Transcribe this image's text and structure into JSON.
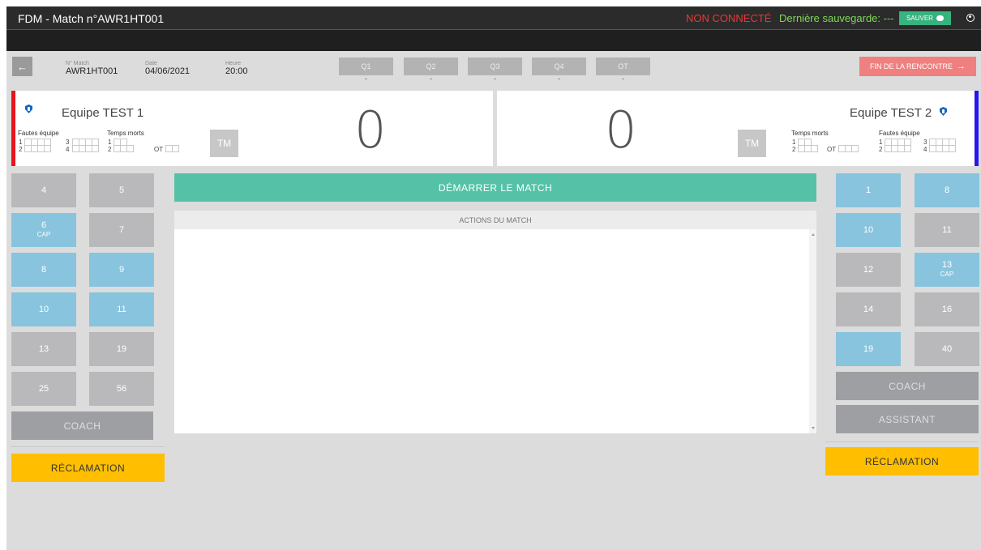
{
  "app": {
    "title": "FDM - Match n°AWR1HT001",
    "connection_status": "NON CONNECTÉ",
    "last_save": "Dernière sauvegarde: ---",
    "save_label": "SAUVER"
  },
  "match_info": {
    "number_label": "N° Match",
    "number": "AWR1HT001",
    "date_label": "Date",
    "date": "04/06/2021",
    "time_label": "Heure",
    "time": "20:00"
  },
  "periods": [
    {
      "label": "Q1",
      "score": "-"
    },
    {
      "label": "Q2",
      "score": "-"
    },
    {
      "label": "Q3",
      "score": "-"
    },
    {
      "label": "Q4",
      "score": "-"
    },
    {
      "label": "OT",
      "score": "-"
    }
  ],
  "end_match_label": "FIN DE LA RENCONTRE",
  "team1": {
    "name": "Equipe TEST 1",
    "score": "0",
    "color": "#e8141c",
    "fouls_label": "Fautes équipe",
    "timeouts_label": "Temps morts",
    "tm_label": "TM",
    "row_labels": [
      "1",
      "2",
      "3",
      "4"
    ],
    "ot_label": "OT",
    "players": [
      {
        "number": "4",
        "cap": "",
        "active": false
      },
      {
        "number": "5",
        "cap": "",
        "active": false
      },
      {
        "number": "6",
        "cap": "CAP",
        "active": true
      },
      {
        "number": "7",
        "cap": "",
        "active": false
      },
      {
        "number": "8",
        "cap": "",
        "active": true
      },
      {
        "number": "9",
        "cap": "",
        "active": true
      },
      {
        "number": "10",
        "cap": "",
        "active": true
      },
      {
        "number": "11",
        "cap": "",
        "active": true
      },
      {
        "number": "13",
        "cap": "",
        "active": false
      },
      {
        "number": "19",
        "cap": "",
        "active": false
      },
      {
        "number": "25",
        "cap": "",
        "active": false
      },
      {
        "number": "56",
        "cap": "",
        "active": false
      }
    ],
    "coach_label": "COACH",
    "claim_label": "RÉCLAMATION"
  },
  "team2": {
    "name": "Equipe TEST 2",
    "score": "0",
    "color": "#2616ec",
    "fouls_label": "Fautes équipe",
    "timeouts_label": "Temps morts",
    "tm_label": "TM",
    "row_labels": [
      "1",
      "2",
      "3",
      "4"
    ],
    "ot_label": "OT",
    "players": [
      {
        "number": "1",
        "cap": "",
        "active": true
      },
      {
        "number": "8",
        "cap": "",
        "active": true
      },
      {
        "number": "10",
        "cap": "",
        "active": true
      },
      {
        "number": "11",
        "cap": "",
        "active": false
      },
      {
        "number": "12",
        "cap": "",
        "active": false
      },
      {
        "number": "13",
        "cap": "CAP",
        "active": true
      },
      {
        "number": "14",
        "cap": "",
        "active": false
      },
      {
        "number": "16",
        "cap": "",
        "active": false
      },
      {
        "number": "19",
        "cap": "",
        "active": true
      },
      {
        "number": "40",
        "cap": "",
        "active": false
      }
    ],
    "coach_label": "COACH",
    "assistant_label": "ASSISTANT",
    "claim_label": "RÉCLAMATION"
  },
  "center": {
    "start_label": "DÉMARRER LE MATCH",
    "actions_title": "ACTIONS DU MATCH"
  }
}
